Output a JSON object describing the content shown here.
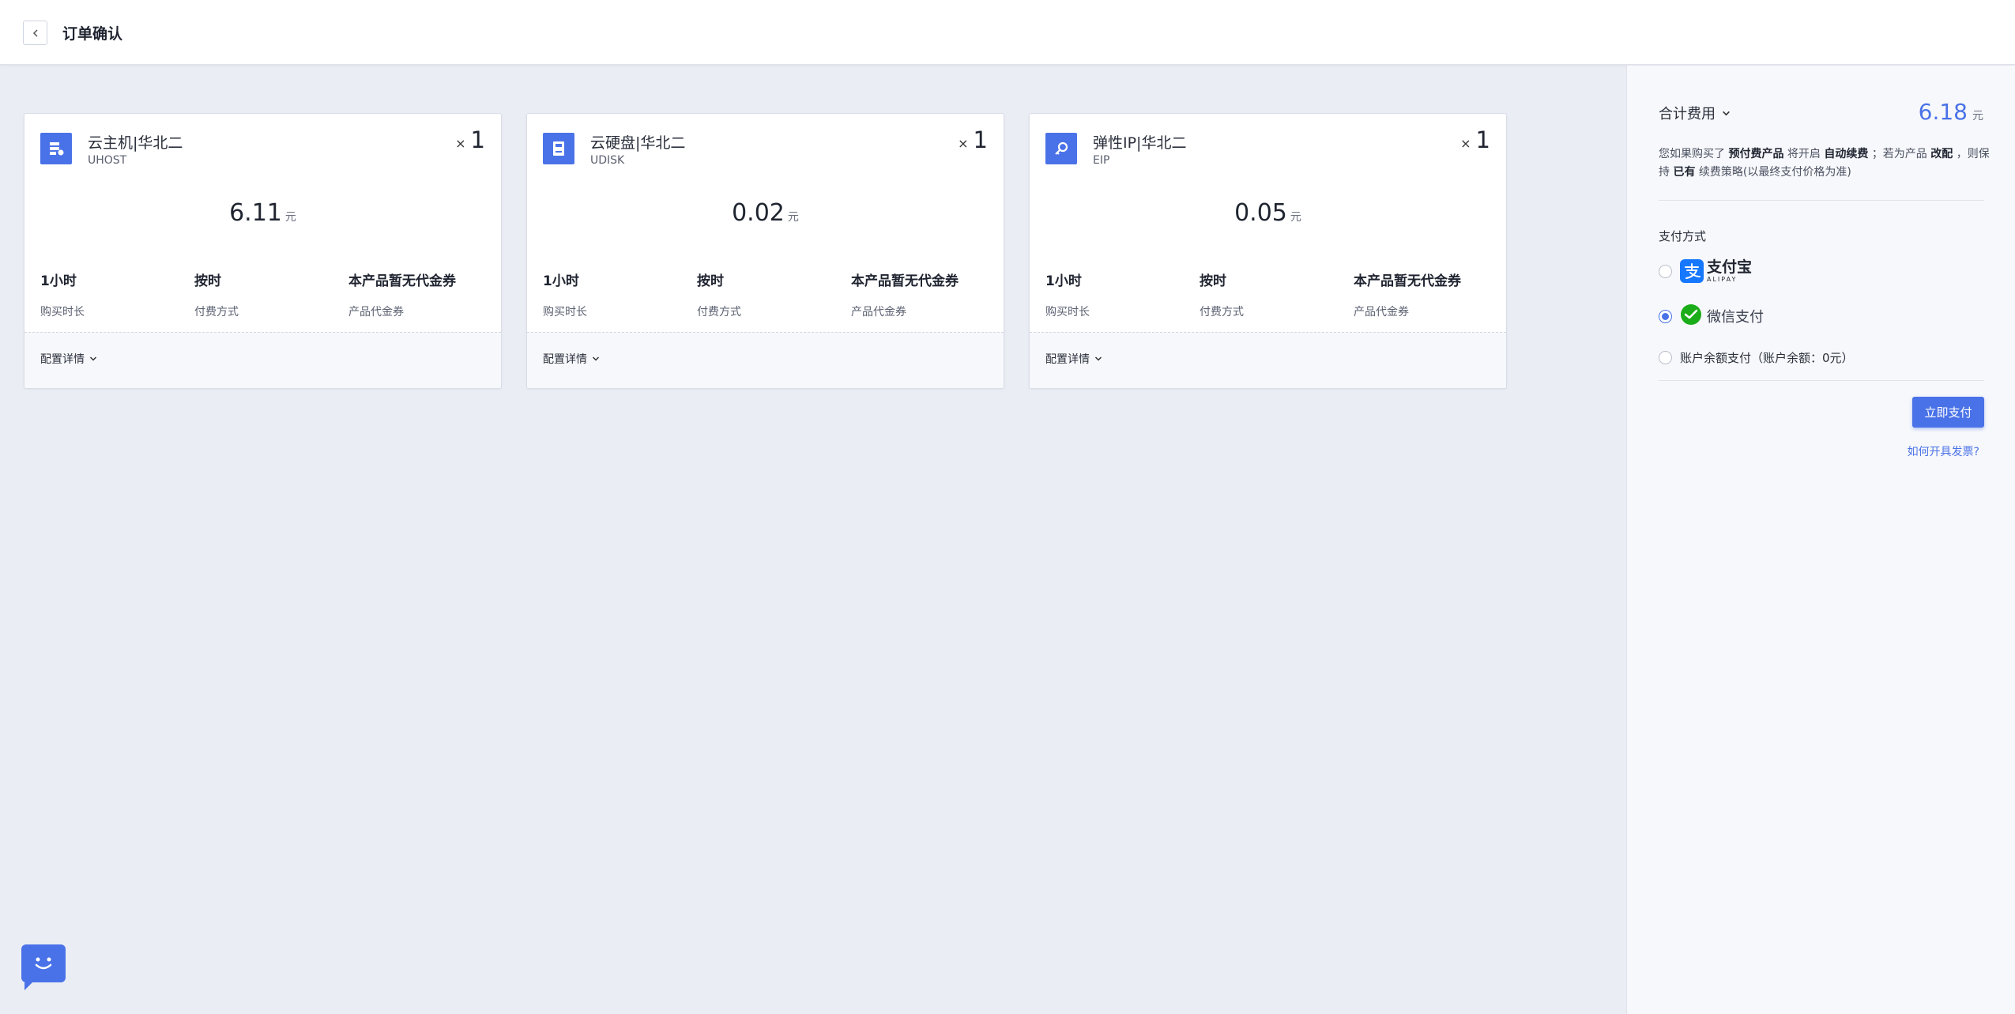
{
  "header": {
    "title": "订单确认"
  },
  "cards": [
    {
      "name": "云主机|华北二",
      "code": "UHOST",
      "qty_prefix": "×",
      "qty": "1",
      "price": "6.11",
      "unit": "元",
      "meta": [
        {
          "value": "1小时",
          "label": "购买时长"
        },
        {
          "value": "按时",
          "label": "付费方式"
        },
        {
          "value": "本产品暂无代金券",
          "label": "产品代金券"
        }
      ],
      "config_label": "配置详情"
    },
    {
      "name": "云硬盘|华北二",
      "code": "UDISK",
      "qty_prefix": "×",
      "qty": "1",
      "price": "0.02",
      "unit": "元",
      "meta": [
        {
          "value": "1小时",
          "label": "购买时长"
        },
        {
          "value": "按时",
          "label": "付费方式"
        },
        {
          "value": "本产品暂无代金券",
          "label": "产品代金券"
        }
      ],
      "config_label": "配置详情"
    },
    {
      "name": "弹性IP|华北二",
      "code": "EIP",
      "qty_prefix": "×",
      "qty": "1",
      "price": "0.05",
      "unit": "元",
      "meta": [
        {
          "value": "1小时",
          "label": "购买时长"
        },
        {
          "value": "按时",
          "label": "付费方式"
        },
        {
          "value": "本产品暂无代金券",
          "label": "产品代金券"
        }
      ],
      "config_label": "配置详情"
    }
  ],
  "side": {
    "total_label": "合计费用",
    "total_amount": "6.18",
    "total_unit": "元",
    "notice": {
      "p1": "您如果购买了",
      "b1": "预付费产品",
      "p2": "将开启",
      "b2": "自动续费",
      "p3": "；若为产品",
      "b3": "改配",
      "p4": "，则保持",
      "b4": "已有",
      "p5": "续费策略(以最终支付价格为准)"
    },
    "pay_title": "支付方式",
    "alipay_cn": "支付宝",
    "alipay_en": "ALIPAY",
    "wechat_label": "微信支付",
    "balance_label": "账户余额支付（账户余额：0元）",
    "selected_method": "wechat",
    "pay_button": "立即支付",
    "invoice_link": "如何开具发票?"
  },
  "colors": {
    "accent": "#4a72e8",
    "alipay": "#1677ff",
    "wechat": "#1aad19"
  },
  "icons": {
    "back": "chevron-left-icon",
    "uhost": "server-icon",
    "udisk": "disk-icon",
    "eip": "key-icon",
    "expand": "chevron-down-icon",
    "chat": "chat-bot-icon"
  }
}
